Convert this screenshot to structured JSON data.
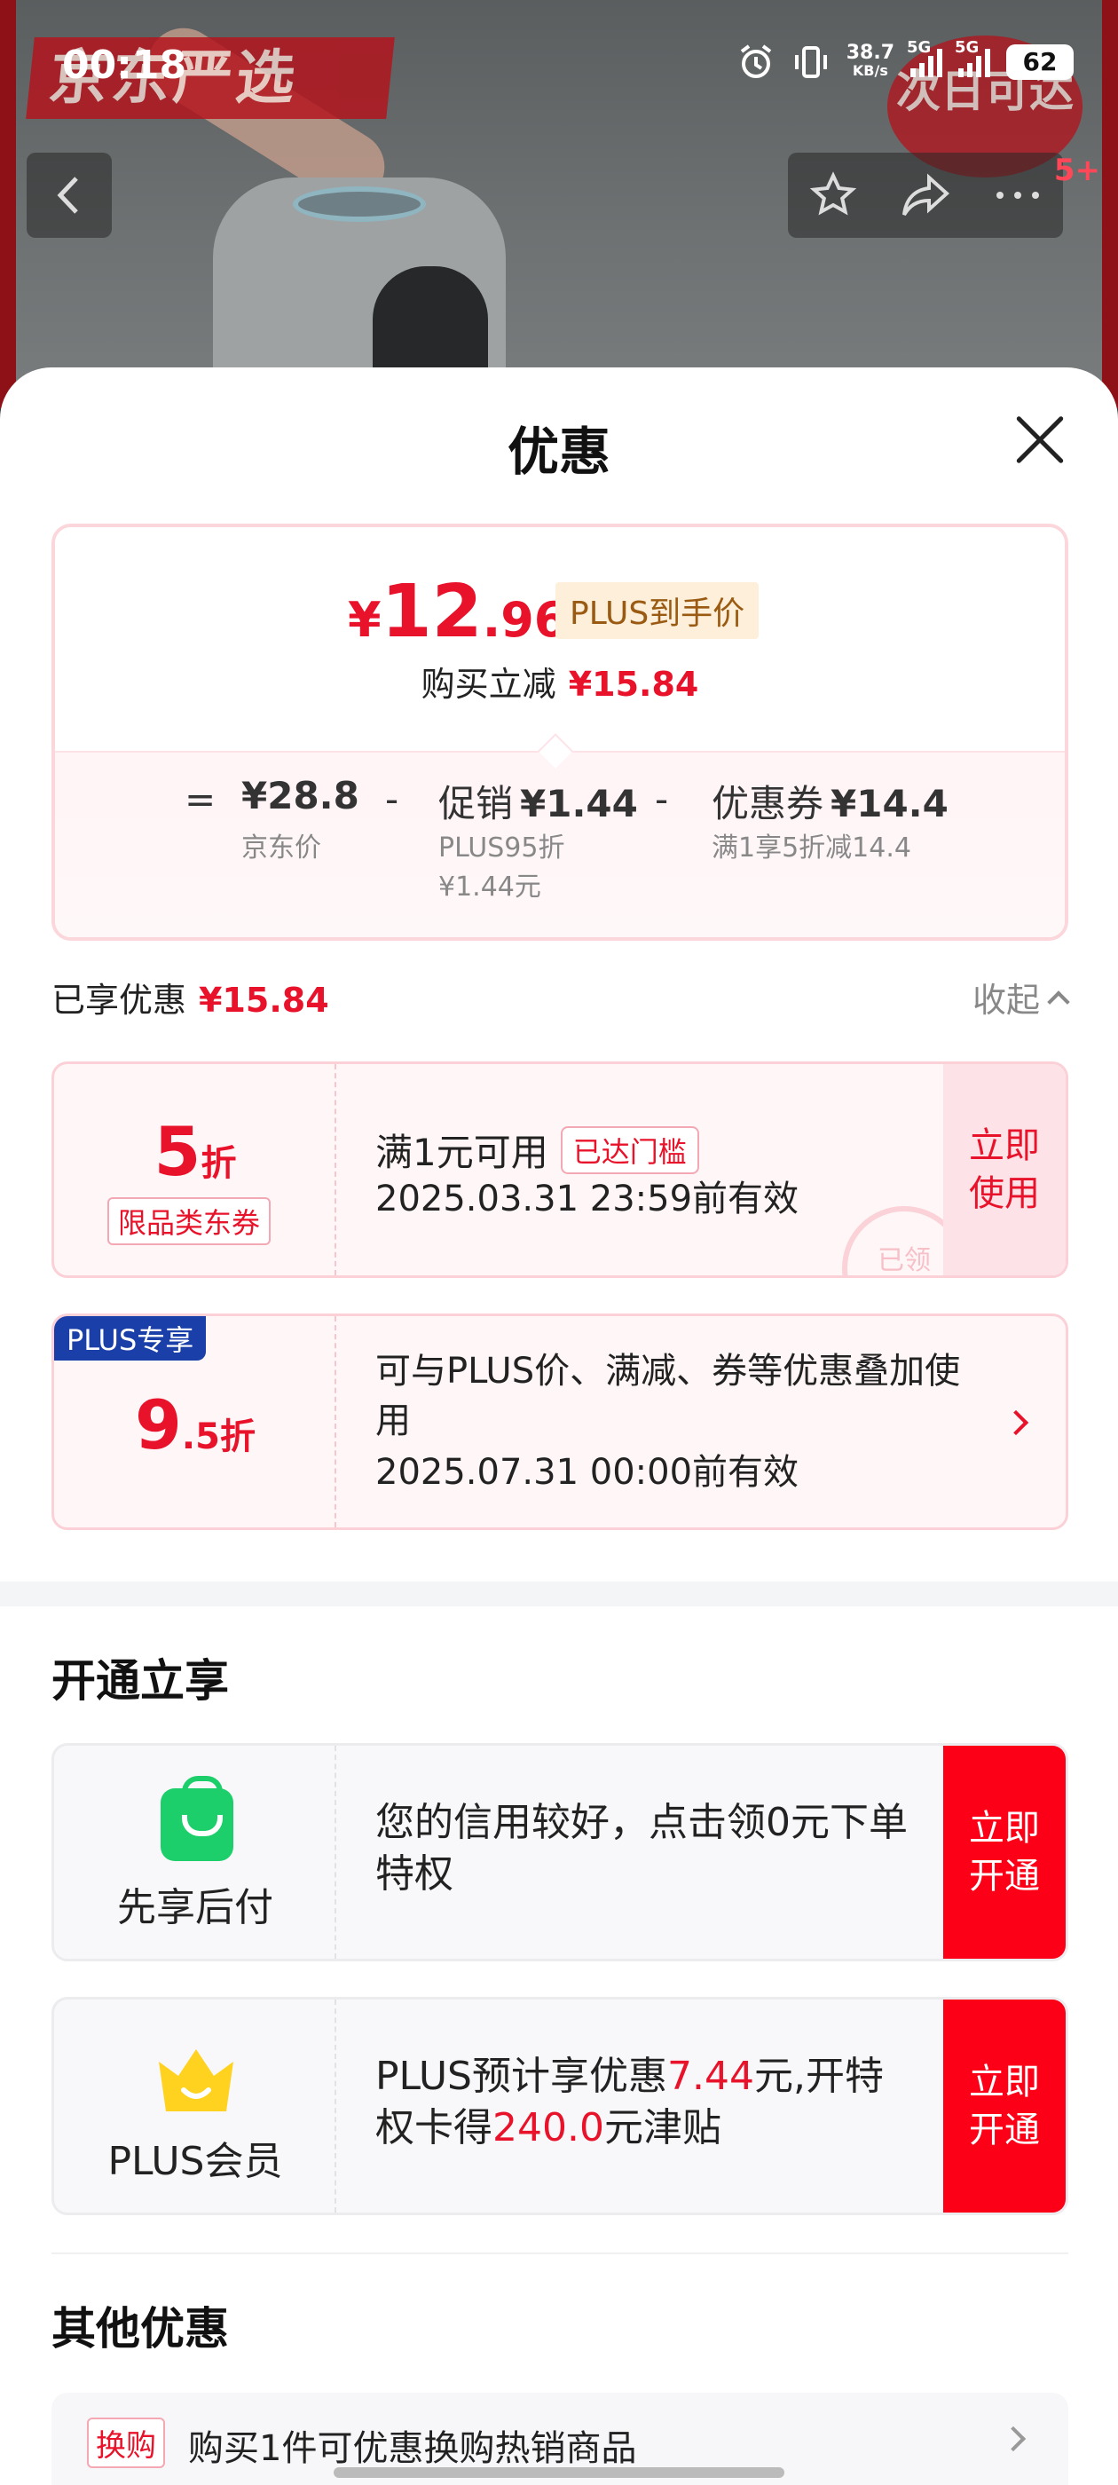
{
  "status_bar": {
    "time": "00:18",
    "net_speed": "38.7",
    "net_unit": "KB/s",
    "sim1": "5G",
    "sim2": "5G",
    "battery": "62"
  },
  "background": {
    "brand": "京东严选",
    "badge_line1": "次日可达",
    "count": "5+"
  },
  "sheet": {
    "title": "优惠"
  },
  "price_card": {
    "currency": "¥",
    "price_int": "12",
    "price_dec": ".96",
    "plus_tag": "PLUS到手价",
    "reduce_label": "购买立减",
    "reduce_amount": "¥15.84",
    "eq_sign": "=",
    "minus_sign": "-",
    "jd_value": "¥28.8",
    "jd_label": "京东价",
    "promo_label": "促销",
    "promo_value": "¥1.44",
    "promo_sub1": "PLUS95折",
    "promo_sub2": "¥1.44元",
    "coupon_label": "优惠券",
    "coupon_value": "¥14.4",
    "coupon_sub": "满1享5折减14.4"
  },
  "enjoyed": {
    "label": "已享优惠",
    "amount": "¥15.84",
    "collapse": "收起"
  },
  "coupon1": {
    "disc_big": "5",
    "disc_small": "折",
    "type": "限品类东券",
    "title": "满1元可用",
    "reached": "已达门槛",
    "valid": "2025.03.31 23:59前有效",
    "btn": "立即使用",
    "stamp": "已领"
  },
  "coupon2": {
    "badge": "PLUS专享",
    "disc_big": "9",
    "disc_small": ".5折",
    "title": "可与PLUS价、满减、券等优惠叠加使用",
    "valid": "2025.07.31 00:00前有效"
  },
  "open_section": {
    "title": "开通立享",
    "card1": {
      "icon_label": "先享后付",
      "desc": "您的信用较好，点击领0元下单特权",
      "btn": "立即开通"
    },
    "card2": {
      "icon_label": "PLUS会员",
      "desc_pre": "PLUS预计享优惠",
      "desc_amt1": "7.44",
      "desc_mid": "元,开特权卡得",
      "desc_amt2": "240.0",
      "desc_post": "元津贴",
      "btn": "立即开通"
    }
  },
  "other_section": {
    "title": "其他优惠",
    "row1_tag": "换购",
    "row1_text": "购买1件可优惠换购热销商品"
  },
  "colors": {
    "accent_red": "#e8132a",
    "button_red": "#fb0017",
    "plus_blue": "#1b3fa8",
    "green": "#1ccf6b"
  }
}
